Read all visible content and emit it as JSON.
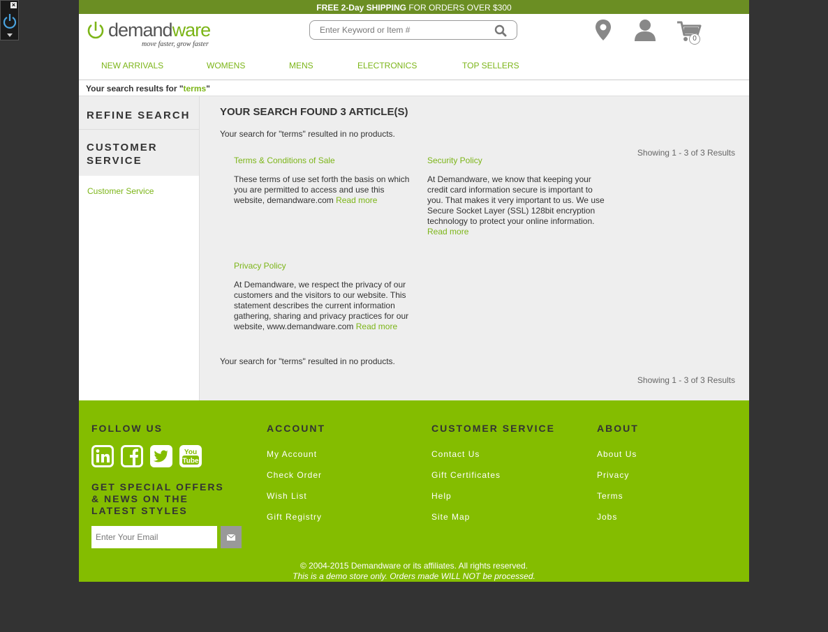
{
  "promo": {
    "bold": "FREE 2-Day SHIPPING",
    "rest": " FOR ORDERS OVER $300"
  },
  "logo": {
    "word_a": "demand",
    "word_b": "ware",
    "tagline": "move faster, grow faster"
  },
  "search": {
    "placeholder": "Enter Keyword or Item #"
  },
  "cart": {
    "count": "0"
  },
  "nav": [
    "NEW ARRIVALS",
    "WOMENS",
    "MENS",
    "ELECTRONICS",
    "TOP SELLERS"
  ],
  "breadcrumb": {
    "prefix": "Your search results for \"",
    "query": "terms",
    "suffix": "\""
  },
  "sidebar": {
    "refine": "REFINE SEARCH",
    "cs_line1": "CUSTOMER",
    "cs_line2": "SERVICE",
    "link": "Customer Service"
  },
  "results": {
    "heading": "YOUR SEARCH FOUND 3 ARTICLE(S)",
    "no_products": "Your search for \"terms\" resulted in no products.",
    "showing": "Showing 1 - 3 of 3 Results",
    "read_more": "Read more",
    "articles": [
      {
        "title": "Terms & Conditions of Sale",
        "body": "These terms of use set forth the basis on which you are permitted to access and use this website, demandware.com "
      },
      {
        "title": "Security Policy",
        "body": "At Demandware, we know that keeping your credit card information secure is important to you. That makes it very important to us. We use Secure Socket Layer (SSL) 128bit encryption technology to protect your online information."
      },
      {
        "title": "Privacy Policy",
        "body": "At Demandware, we respect the privacy of our customers and the visitors to our website. This statement describes the current information gathering, sharing and privacy practices for our website, www.demandware.com "
      }
    ]
  },
  "footer": {
    "follow": "FOLLOW US",
    "offers": "GET SPECIAL OFFERS & NEWS ON THE LATEST STYLES",
    "email_placeholder": "Enter Your Email",
    "account": {
      "heading": "ACCOUNT",
      "links": [
        "My Account",
        "Check Order",
        "Wish List",
        "Gift Registry"
      ]
    },
    "customer_service": {
      "heading": "CUSTOMER SERVICE",
      "links": [
        "Contact Us",
        "Gift Certificates",
        "Help",
        "Site Map"
      ]
    },
    "about": {
      "heading": "ABOUT",
      "links": [
        "About Us",
        "Privacy",
        "Terms",
        "Jobs"
      ]
    },
    "copyright": "© 2004-2015 Demandware or its affiliates. All rights reserved.",
    "demo_note": "This is a demo store only. Orders made WILL NOT be processed."
  },
  "colors": {
    "brand_green": "#84bd00",
    "link_green": "#7cb518",
    "promo_bar": "#6b8e23"
  }
}
